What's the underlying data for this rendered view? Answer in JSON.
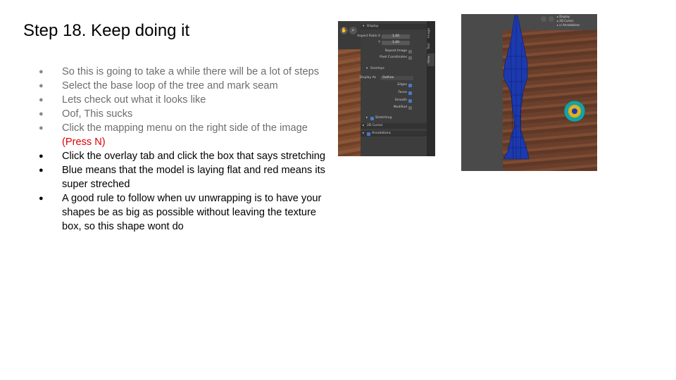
{
  "slide": {
    "title": "Step 18. Keep doing it",
    "bullets": [
      {
        "text": "So this is going to take a while there will be a lot of steps",
        "style": "gray"
      },
      {
        "text": "Select the base loop of the tree and mark seam",
        "style": "gray"
      },
      {
        "text": "Lets check out what it looks like",
        "style": "gray"
      },
      {
        "text": "Oof, This sucks",
        "style": "gray"
      },
      {
        "text": "Click the mapping menu on the right side of the image",
        "note": "(Press N)",
        "style": "gray"
      },
      {
        "text": "Click the overlay tab and click the box that says stretching",
        "style": "dark"
      },
      {
        "text": "Blue means that the model is laying flat and red means its super streched",
        "style": "dark"
      },
      {
        "text": "A good rule to follow when uv unwrapping is to have your shapes be as big as possible without leaving the texture box, so this shape wont do",
        "style": "dark"
      }
    ]
  },
  "panel": {
    "tabs": [
      "Image",
      "Tool",
      "View"
    ],
    "display_header": "Display",
    "aspect_x_label": "Aspect Ratio X",
    "aspect_x_value": "1.00",
    "aspect_y_label": "Y",
    "aspect_y_value": "1.00",
    "repeat_image": "Repeat Image",
    "pixel_coordinates": "Pixel Coordinates",
    "overlays_header": "Overlays",
    "display_as_label": "Display As",
    "display_as_value": "Outline",
    "edges": "Edges",
    "faces": "Faces",
    "smooth": "Smooth",
    "modified": "Modified",
    "stretching": "Stretching",
    "cursor_2d": "2D Cursor",
    "annotations": "Annotations"
  },
  "uv_view": {
    "menu_items": [
      "Display",
      "2D Cursor",
      "Annotations"
    ]
  },
  "colors": {
    "accent_red": "#e00000",
    "checkbox_blue": "#4a78c8",
    "uv_blue": "#1a3aa8"
  }
}
